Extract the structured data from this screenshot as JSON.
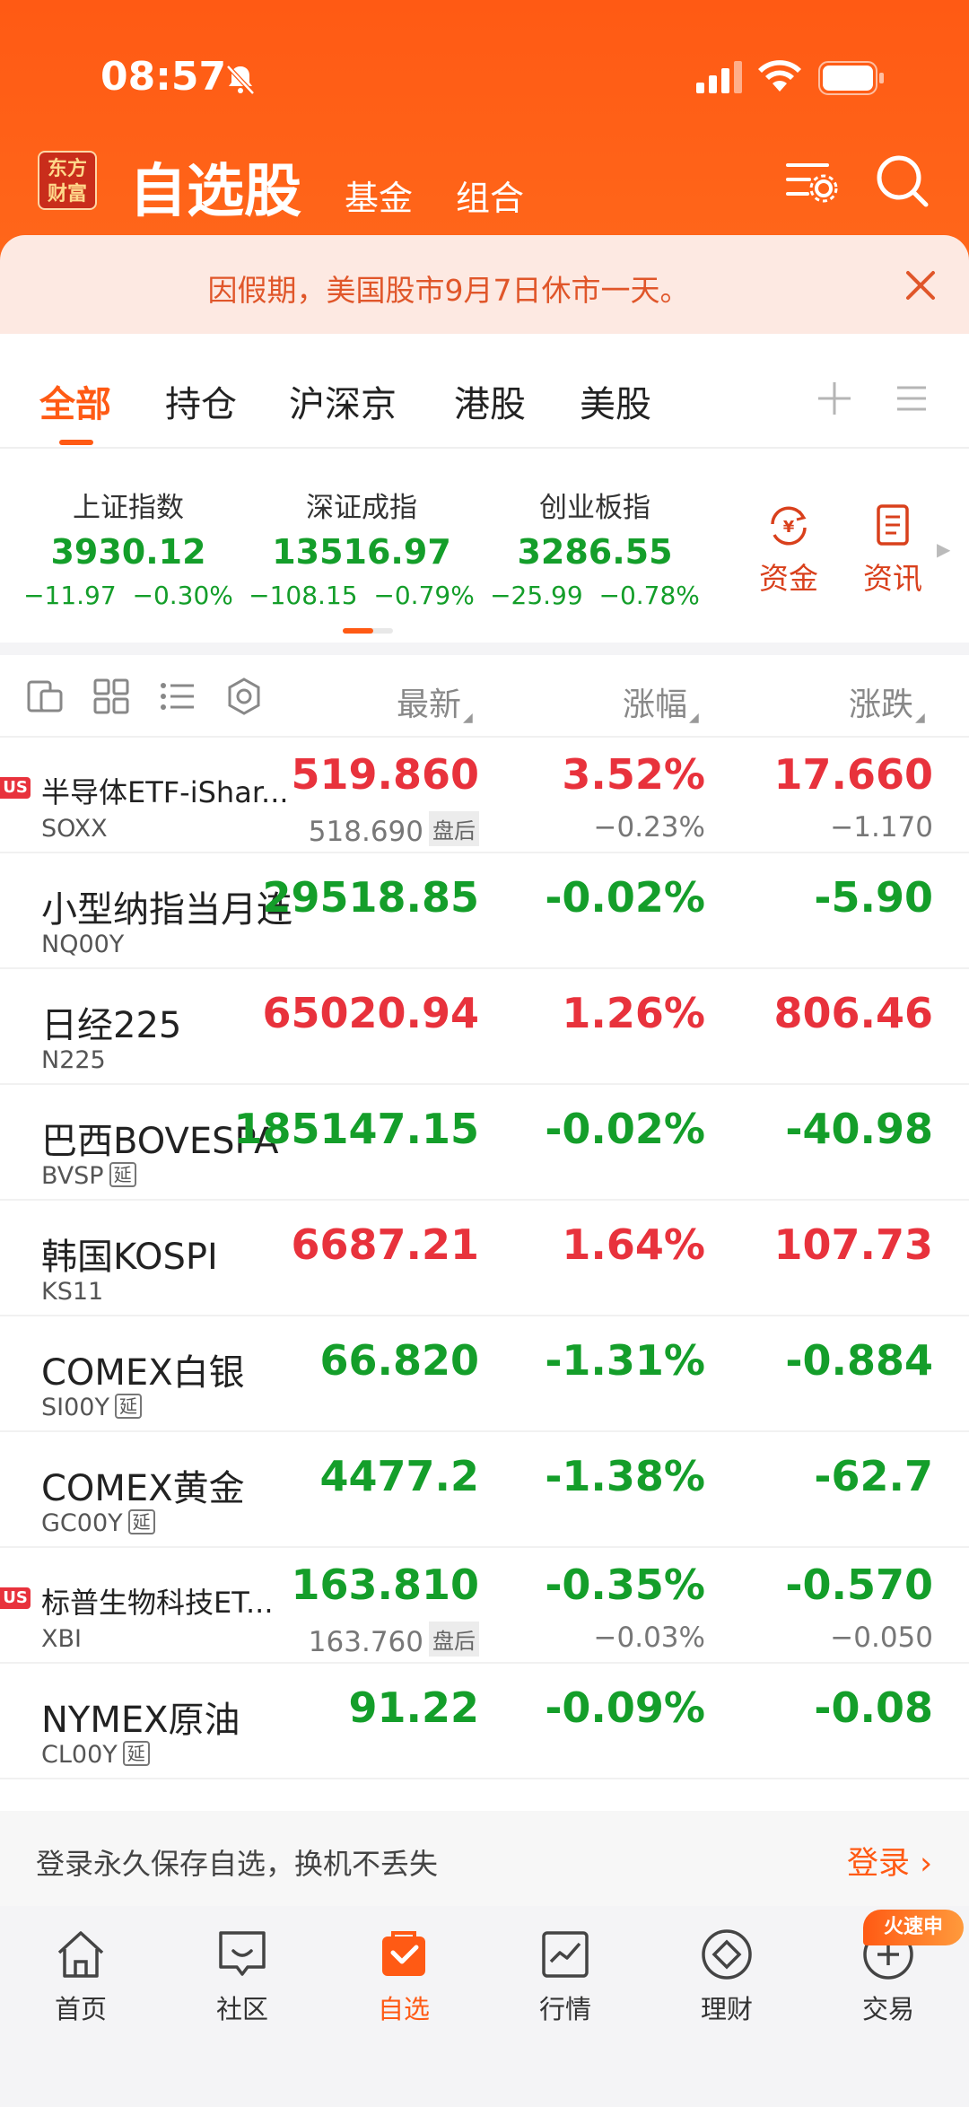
{
  "status": {
    "time": "08:57"
  },
  "header": {
    "logo": "东方财富",
    "title": "自选股",
    "tabs": [
      "基金",
      "组合"
    ]
  },
  "notice": {
    "text": "因假期，美国股市9月7日休市一天。"
  },
  "tabs": [
    "全部",
    "持仓",
    "沪深京",
    "港股",
    "美股"
  ],
  "indices": [
    {
      "name": "上证指数",
      "value": "3930.12",
      "change": "−11.97",
      "pct": "−0.30%"
    },
    {
      "name": "深证成指",
      "value": "13516.97",
      "change": "−108.15",
      "pct": "−0.79%"
    },
    {
      "name": "创业板指",
      "value": "3286.55",
      "change": "−25.99",
      "pct": "−0.78%"
    }
  ],
  "index_tools": [
    "资金",
    "资讯"
  ],
  "list_header": {
    "latest": "最新",
    "pct": "涨幅",
    "chg": "涨跌"
  },
  "rows": [
    {
      "badge": "US",
      "name": "半导体ETF-iShar...",
      "code": "SOXX",
      "price": "519.860",
      "pct": "3.52%",
      "chg": "17.660",
      "dir": "up",
      "sub_price": "518.690",
      "sub_tag": "盘后",
      "sub_pct": "−0.23%",
      "sub_chg": "−1.170"
    },
    {
      "name": "小型纳指当月连续",
      "code": "NQ00Y",
      "price": "29518.85",
      "pct": "-0.02%",
      "chg": "-5.90",
      "dir": "down"
    },
    {
      "name": "日经225",
      "code": "N225",
      "price": "65020.94",
      "pct": "1.26%",
      "chg": "806.46",
      "dir": "up"
    },
    {
      "name": "巴西BOVESPA",
      "code": "BVSP",
      "delay": "延",
      "price": "185147.15",
      "pct": "-0.02%",
      "chg": "-40.98",
      "dir": "down"
    },
    {
      "name": "韩国KOSPI",
      "code": "KS11",
      "price": "6687.21",
      "pct": "1.64%",
      "chg": "107.73",
      "dir": "up"
    },
    {
      "name": "COMEX白银",
      "code": "SI00Y",
      "delay": "延",
      "price": "66.820",
      "pct": "-1.31%",
      "chg": "-0.884",
      "dir": "down"
    },
    {
      "name": "COMEX黄金",
      "code": "GC00Y",
      "delay": "延",
      "price": "4477.2",
      "pct": "-1.38%",
      "chg": "-62.7",
      "dir": "down"
    },
    {
      "badge": "US",
      "name": "标普生物科技ET...",
      "code": "XBI",
      "price": "163.810",
      "pct": "-0.35%",
      "chg": "-0.570",
      "dir": "down",
      "sub_price": "163.760",
      "sub_tag": "盘后",
      "sub_pct": "−0.03%",
      "sub_chg": "−0.050"
    },
    {
      "name": "NYMEX原油",
      "code": "CL00Y",
      "delay": "延",
      "price": "91.22",
      "pct": "-0.09%",
      "chg": "-0.08",
      "dir": "down"
    }
  ],
  "login": {
    "text": "登录永久保存自选，换机不丢失",
    "link": "登录"
  },
  "nav": [
    "首页",
    "社区",
    "自选",
    "行情",
    "理财",
    "交易"
  ],
  "promo": "火速申",
  "colors": {
    "brand": "#ff5a14",
    "up": "#e8323c",
    "down": "#149e2a"
  }
}
